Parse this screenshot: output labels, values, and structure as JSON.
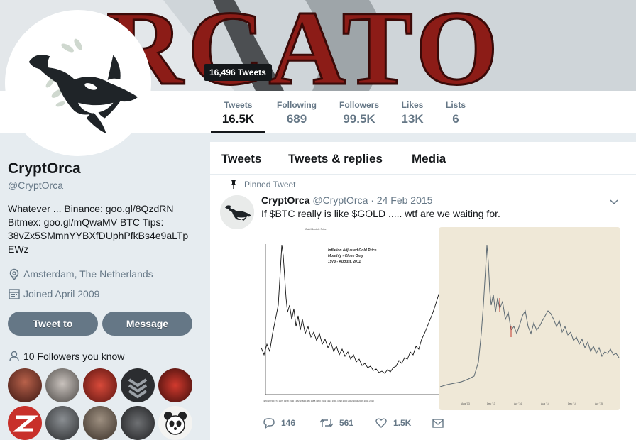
{
  "colors": {
    "text": "#14171a",
    "muted": "#657786",
    "banner_red": "#8c1c17",
    "chart_bg": "#efe8d7"
  },
  "header": {
    "banner_text": "RCATO",
    "tweets_tooltip": "16,496 Tweets"
  },
  "stats": [
    {
      "label": "Tweets",
      "value": "16.5K",
      "active": true
    },
    {
      "label": "Following",
      "value": "689"
    },
    {
      "label": "Followers",
      "value": "99.5K"
    },
    {
      "label": "Likes",
      "value": "13K"
    },
    {
      "label": "Lists",
      "value": "6"
    }
  ],
  "profile": {
    "name": "CryptOrca",
    "handle": "@CryptOrca",
    "bio_lines": [
      "Whatever ... Binance: goo.gl/8QzdRN",
      "Bitmex: goo.gl/mQwaMV BTC Tips:",
      "38vZx5SMmnYYBXfDUphPfkBs4e9aLTp",
      "EWz"
    ],
    "location": "Amsterdam, The Netherlands",
    "joined": "Joined April 2009",
    "location_icon": "location-pin-icon",
    "calendar_icon": "calendar-icon"
  },
  "buttons": {
    "tweet_to": "Tweet to",
    "message": "Message"
  },
  "followers_you_know": "10 Followers you know",
  "tabs": [
    "Tweets",
    "Tweets & replies",
    "Media"
  ],
  "tweet": {
    "pinned_label": "Pinned Tweet",
    "name": "CryptOrca",
    "handle": "@CryptOrca",
    "separator": "·",
    "date": "24 Feb 2015",
    "text": "If $BTC really is like $GOLD ..... wtf are we waiting for.",
    "gold_chart_caption": [
      "Inflation Adjusted Gold Price",
      "Monthly - Close Only",
      "1970 - August, 2011"
    ],
    "actions": {
      "replies": "146",
      "retweets": "561",
      "likes": "1.5K"
    }
  }
}
